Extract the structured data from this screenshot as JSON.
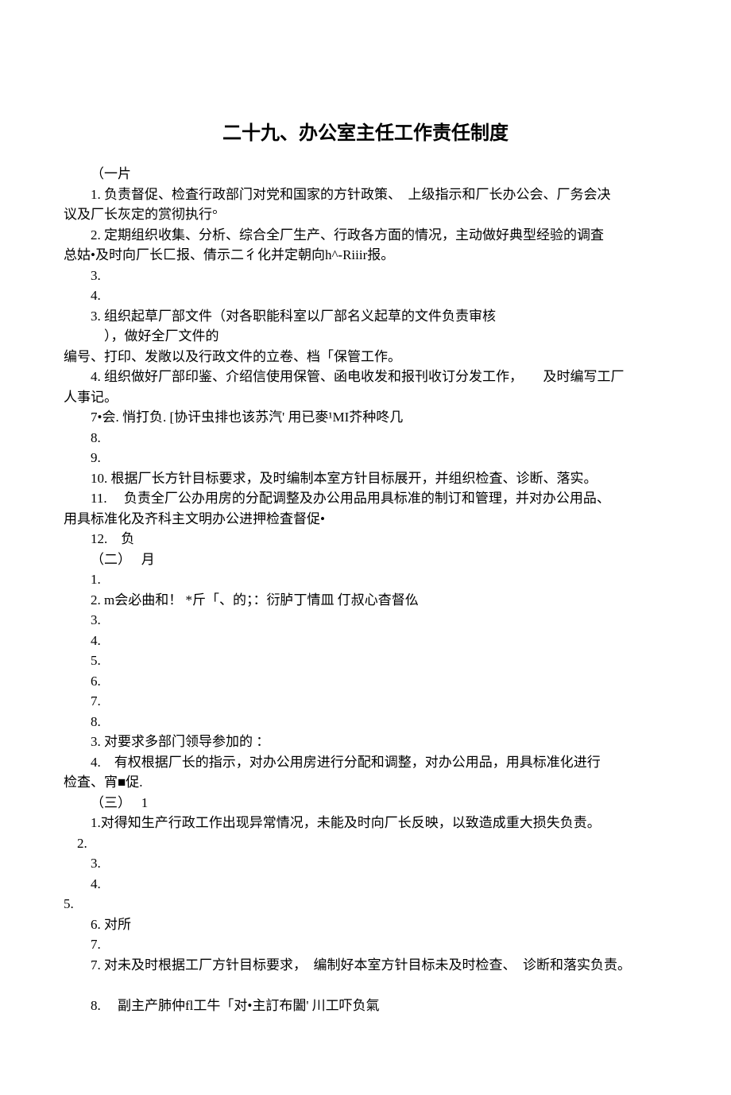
{
  "title": "二十九、办公室主任工作责任制度",
  "lines": [
    {
      "indent": 1,
      "text": "（一片"
    },
    {
      "indent": 1,
      "text": "1. 负责督促、检査行政部门对党和国家的方针政策、　上级指示和厂长办公会、厂务会决"
    },
    {
      "indent": 0,
      "text": "议及厂长灰定的赏彻执行°"
    },
    {
      "indent": 1,
      "text": "2. 定期组织收集、分析、综合全厂生产、行政各方面的情况，主动做好典型经验的调査"
    },
    {
      "indent": 0,
      "text": "总姑•及时向厂长匚报、倩示二彳化并定朝向h^-Riiir报。"
    },
    {
      "indent": 1,
      "text": "3."
    },
    {
      "indent": 1,
      "text": "4."
    },
    {
      "indent": 1,
      "text": "3. 组织起草厂部文件（对各职能科室以厂部名义起草的文件负责审核"
    },
    {
      "indent": 2,
      "text": "），做好全厂文件的"
    },
    {
      "indent": 0,
      "text": "编号、打印、发敞以及行政文件的立卷、档「保管工作。"
    },
    {
      "indent": 1,
      "text": "4. 组织做好厂部印鉴、介绍信使用保管、函电收发和报刊收订分发工作，　　及时编写工厂"
    },
    {
      "indent": 0,
      "text": "人事记。"
    },
    {
      "indent": 1,
      "text": "7•会. 悄打负. [协讦虫排也该苏汽' 用已麥¹MI芥种咚几"
    },
    {
      "indent": 1,
      "text": "8."
    },
    {
      "indent": 1,
      "text": "9."
    },
    {
      "indent": 1,
      "text": "10. 根据厂长方针目标要求，及时编制本室方针目标展开，并组织检査、诊断、落实。"
    },
    {
      "indent": 1,
      "text": "11. 　负责全厂公办用房的分配调整及办公用品用具标准的制订和管理，并对办公用品、"
    },
    {
      "indent": 0,
      "text": "用具标准化及齐科主文明办公进押检査督促•"
    },
    {
      "indent": 1,
      "text": "12.　负"
    },
    {
      "indent": 1,
      "text": "（二）　 月"
    },
    {
      "indent": 1,
      "text": "1."
    },
    {
      "indent": 1,
      "text": "2. m会必曲和！ *斤「、的；：衍胪丁情皿 仃叔心杳督仫"
    },
    {
      "indent": 1,
      "text": "3."
    },
    {
      "indent": 1,
      "text": "4."
    },
    {
      "indent": 1,
      "text": "5."
    },
    {
      "indent": 1,
      "text": "6."
    },
    {
      "indent": 1,
      "text": "7."
    },
    {
      "indent": 1,
      "text": "8."
    },
    {
      "indent": 1,
      "text": "3. 对要求多部门领导参加的 ："
    },
    {
      "indent": 1,
      "text": "4.　有权根据厂长的指示，对办公用房进行分配和调整，对办公用品，用具标准化进行"
    },
    {
      "indent": 0,
      "text": "检査、宵■促."
    },
    {
      "indent": 1,
      "text": "（三）　 1"
    },
    {
      "indent": 1,
      "text": "1.对得知生产行政工作出现异常情况，未能及时向厂长反映，以致造成重大损失负责。"
    },
    {
      "indent": 0,
      "text": "　2."
    },
    {
      "indent": 1,
      "text": "3."
    },
    {
      "indent": 1,
      "text": "4."
    },
    {
      "indent": 0,
      "text": "5."
    },
    {
      "indent": 1,
      "text": "6. 对所"
    },
    {
      "indent": 1,
      "text": "7."
    },
    {
      "indent": 1,
      "text": "7. 对未及时根据工厂方针目标要求，　编制好本室方针目标未及时检查、　诊断和落实负责。"
    },
    {
      "indent": 1,
      "text": ""
    },
    {
      "indent": 1,
      "text": "8.　 副主产肺仲fl工牛「对•主訂布闔' 川工吓负氣"
    }
  ]
}
